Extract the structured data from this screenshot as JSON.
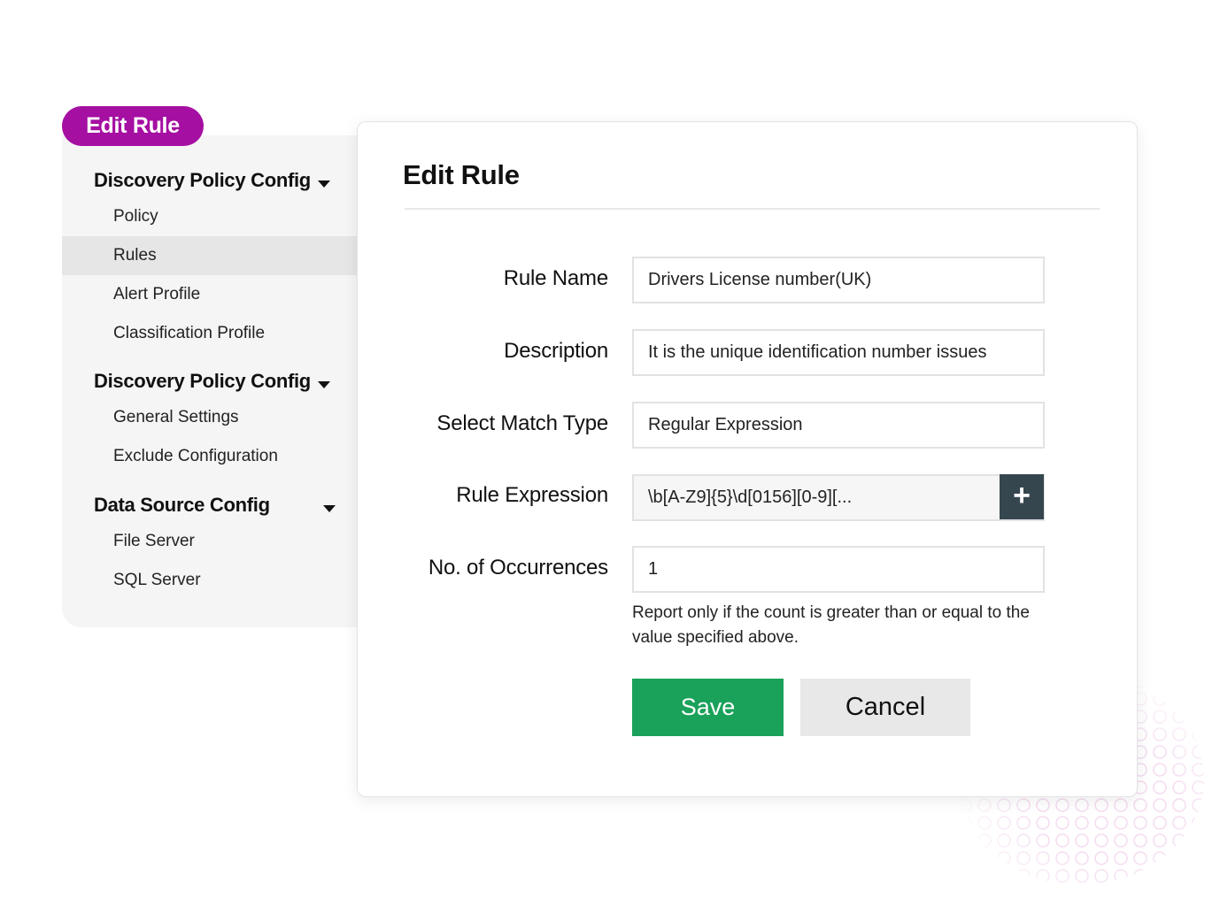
{
  "badge": {
    "label": "Edit Rule"
  },
  "sidebar": {
    "sections": [
      {
        "heading": "Discovery Policy Config",
        "items": [
          {
            "label": "Policy",
            "active": false
          },
          {
            "label": "Rules",
            "active": true
          },
          {
            "label": "Alert Profile",
            "active": false
          },
          {
            "label": "Classification Profile",
            "active": false
          }
        ]
      },
      {
        "heading": "Discovery Policy Config",
        "items": [
          {
            "label": "General Settings",
            "active": false
          },
          {
            "label": "Exclude Configuration",
            "active": false
          }
        ]
      },
      {
        "heading": "Data Source Config",
        "items": [
          {
            "label": "File Server",
            "active": false
          },
          {
            "label": "SQL Server",
            "active": false
          }
        ]
      }
    ]
  },
  "form": {
    "title": "Edit Rule",
    "fields": {
      "rule_name": {
        "label": "Rule Name",
        "value": "Drivers License number(UK)"
      },
      "description": {
        "label": "Description",
        "value": "It is the unique identification number issues"
      },
      "match_type": {
        "label": "Select Match Type",
        "value": "Regular Expression"
      },
      "rule_expression": {
        "label": "Rule Expression",
        "value": "\\b[A-Z9]{5}\\d[0156][0-9][..."
      },
      "occurrences": {
        "label": "No. of Occurrences",
        "value": "1"
      }
    },
    "hint_line1": "Report only if the count is greater than or equal to the",
    "hint_line2": "value specified above.",
    "save_label": "Save",
    "cancel_label": "Cancel",
    "add_glyph": "+"
  },
  "colors": {
    "badge": "#a50fa2",
    "save": "#1aa15a",
    "add_button": "#35464f"
  }
}
